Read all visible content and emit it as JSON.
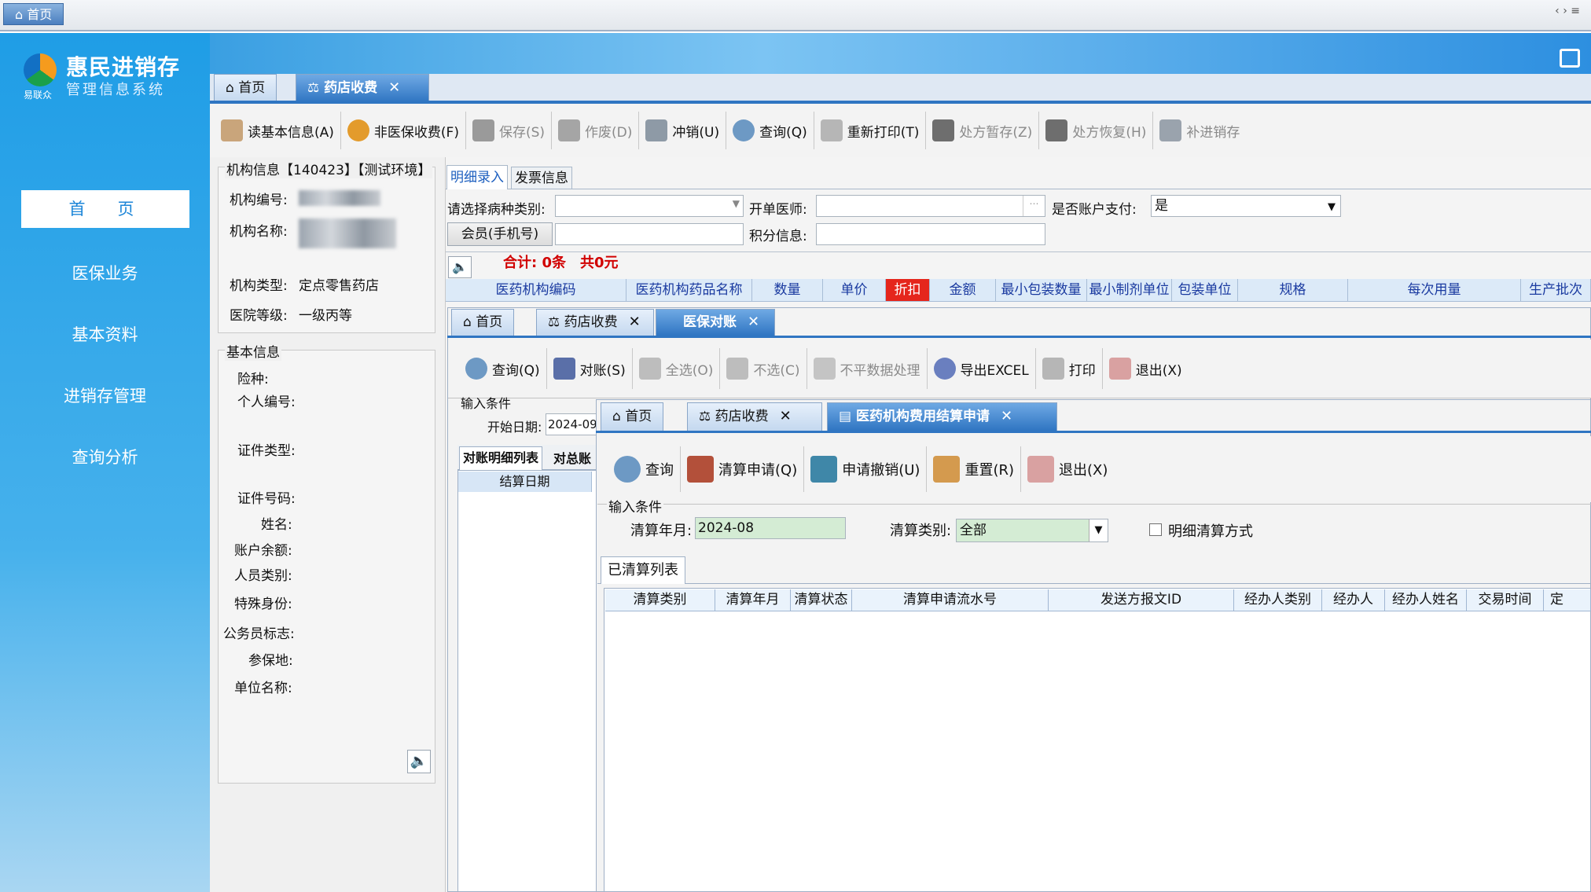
{
  "window": {
    "tab": "首页"
  },
  "sidebar": {
    "brand": "惠民进销存",
    "subtitle": "管理信息系统",
    "small": "易联众",
    "items": [
      "首　页",
      "医保业务",
      "基本资料",
      "进销存管理",
      "查询分析"
    ]
  },
  "tabs1": {
    "home": "首页",
    "pharmacy": "药店收费"
  },
  "toolbar1": [
    {
      "label": "读基本信息(A)",
      "enabled": true
    },
    {
      "label": "非医保收费(F)",
      "enabled": true
    },
    {
      "label": "保存(S)",
      "enabled": false
    },
    {
      "label": "作废(D)",
      "enabled": false
    },
    {
      "label": "冲销(U)",
      "enabled": true
    },
    {
      "label": "查询(Q)",
      "enabled": true
    },
    {
      "label": "重新打印(T)",
      "enabled": true
    },
    {
      "label": "处方暂存(Z)",
      "enabled": false
    },
    {
      "label": "处方恢复(H)",
      "enabled": false
    },
    {
      "label": "补进销存",
      "enabled": false
    }
  ],
  "org": {
    "title": "机构信息【140423】【测试环境】",
    "code_label": "机构编号:",
    "name_label": "机构名称:",
    "type_label": "机构类型:",
    "type_value": "定点零售药店",
    "level_label": "医院等级:",
    "level_value": "一级丙等"
  },
  "basic": {
    "title": "基本信息",
    "fields": [
      "险种:",
      "个人编号:",
      "证件类型:",
      "证件号码:",
      "姓名:",
      "账户余额:",
      "人员类别:",
      "特殊身份:",
      "公务员标志:",
      "参保地:",
      "单位名称:"
    ]
  },
  "entry": {
    "tab_detail": "明细录入",
    "tab_invoice": "发票信息",
    "disease_label": "请选择病种类别:",
    "doctor_label": "开单医师:",
    "account_label": "是否账户支付:",
    "account_value": "是",
    "member_btn": "会员(手机号)",
    "points_label": "积分信息:",
    "total": "合计: 0条　共0元",
    "columns": [
      "医药机构编码",
      "医药机构药品名称",
      "数量",
      "单价",
      "折扣",
      "金额",
      "最小包装数量",
      "最小制剂单位",
      "包装单位",
      "规格",
      "每次用量",
      "生产批次"
    ]
  },
  "tabs2": {
    "home": "首页",
    "pharmacy": "药店收费",
    "recon": "医保对账"
  },
  "toolbar2": [
    {
      "label": "查询(Q)",
      "enabled": true
    },
    {
      "label": "对账(S)",
      "enabled": true
    },
    {
      "label": "全选(O)",
      "enabled": false
    },
    {
      "label": "不选(C)",
      "enabled": false
    },
    {
      "label": "不平数据处理",
      "enabled": false
    },
    {
      "label": "导出EXCEL",
      "enabled": true
    },
    {
      "label": "打印",
      "enabled": true
    },
    {
      "label": "退出(X)",
      "enabled": true
    }
  ],
  "recon": {
    "cond_title": "输入条件",
    "start_label": "开始日期:",
    "start_value": "2024-09",
    "list_tab1": "对账明细列表",
    "list_tab2": "对总账",
    "col": "结算日期"
  },
  "tabs3": {
    "home": "首页",
    "pharmacy": "药店收费",
    "settle": "医药机构费用结算申请"
  },
  "toolbar3": [
    {
      "label": "查询",
      "enabled": true
    },
    {
      "label": "清算申请(Q)",
      "enabled": true
    },
    {
      "label": "申请撤销(U)",
      "enabled": true
    },
    {
      "label": "重置(R)",
      "enabled": true
    },
    {
      "label": "退出(X)",
      "enabled": true
    }
  ],
  "settle": {
    "cond_title": "输入条件",
    "month_label": "清算年月:",
    "month_value": "2024-08",
    "type_label": "清算类别:",
    "type_value": "全部",
    "detail_mode": "明细清算方式",
    "list_tab": "已清算列表",
    "columns": [
      "清算类别",
      "清算年月",
      "清算状态",
      "清算申请流水号",
      "发送方报文ID",
      "经办人类别",
      "经办人",
      "经办人姓名",
      "交易时间",
      "定"
    ]
  },
  "colors": {
    "accent": "#2f75c2",
    "sidebar": "#1f9de6",
    "discount": "#e5261c",
    "total": "#d10000"
  }
}
